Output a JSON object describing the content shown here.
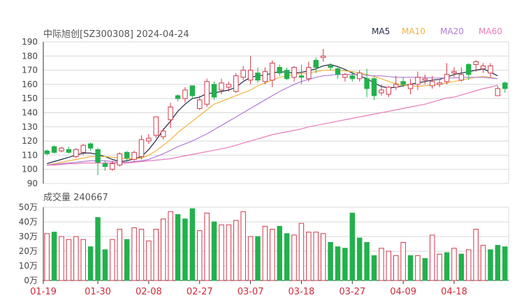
{
  "header": {
    "title": "中际旭创[SZ300308] 2024-04-24",
    "volume_label": "成交量 240667"
  },
  "legend": [
    {
      "label": "MA5",
      "color": "#1f2a44"
    },
    {
      "label": "MA10",
      "color": "#f2b33d"
    },
    {
      "label": "MA20",
      "color": "#b07ad6"
    },
    {
      "label": "MA60",
      "color": "#e87bb8"
    }
  ],
  "colors": {
    "up": "#d0384a",
    "down": "#22b14c",
    "xtick": "#d02a3b",
    "grid": "#d8d8d8"
  },
  "chart_data": [
    {
      "type": "candlestick",
      "title": "中际旭创[SZ300308] 2024-04-24",
      "ylim": [
        90,
        190
      ],
      "yticks": [
        "190",
        "180",
        "170",
        "160",
        "150",
        "140",
        "130",
        "120",
        "110",
        "100",
        "90"
      ],
      "xticks": [
        {
          "index": 0,
          "label": "01-19"
        },
        {
          "index": 7,
          "label": "01-30"
        },
        {
          "index": 14,
          "label": "02-08"
        },
        {
          "index": 21,
          "label": "02-27"
        },
        {
          "index": 28,
          "label": "03-07"
        },
        {
          "index": 35,
          "label": "03-18"
        },
        {
          "index": 42,
          "label": "03-27"
        },
        {
          "index": 49,
          "label": "04-09"
        },
        {
          "index": 56,
          "label": "04-18"
        }
      ],
      "candles": [
        [
          113,
          111,
          114,
          110
        ],
        [
          116,
          112,
          117,
          111
        ],
        [
          113,
          115,
          116,
          112
        ],
        [
          114,
          112,
          116,
          111
        ],
        [
          109,
          114,
          115,
          108
        ],
        [
          112,
          117,
          118,
          110
        ],
        [
          118,
          115,
          119,
          113
        ],
        [
          114,
          105,
          115,
          96
        ],
        [
          104,
          102,
          106,
          99
        ],
        [
          100,
          104,
          106,
          99
        ],
        [
          103,
          111,
          112,
          102
        ],
        [
          112,
          108,
          113,
          106
        ],
        [
          107,
          112,
          113,
          106
        ],
        [
          109,
          121,
          124,
          107
        ],
        [
          120,
          122,
          125,
          118
        ],
        [
          124,
          137,
          137,
          122
        ],
        [
          123,
          127,
          129,
          121
        ],
        [
          135,
          144,
          147,
          129
        ],
        [
          152,
          150,
          153,
          148
        ],
        [
          150,
          156,
          158,
          147
        ],
        [
          159,
          152,
          159,
          150
        ],
        [
          143,
          149,
          152,
          142
        ],
        [
          146,
          162,
          164,
          144
        ],
        [
          160,
          151,
          162,
          149
        ],
        [
          156,
          161,
          164,
          153
        ],
        [
          158,
          160,
          162,
          155
        ],
        [
          155,
          166,
          168,
          154
        ],
        [
          165,
          170,
          173,
          163
        ],
        [
          163,
          170,
          180,
          160
        ],
        [
          168,
          163,
          172,
          161
        ],
        [
          162,
          169,
          172,
          160
        ],
        [
          163,
          175,
          177,
          158
        ],
        [
          172,
          168,
          174,
          166
        ],
        [
          170,
          164,
          172,
          163
        ],
        [
          165,
          172,
          173,
          162
        ],
        [
          166,
          165,
          174,
          160
        ],
        [
          164,
          172,
          176,
          162
        ],
        [
          177,
          172,
          179,
          168
        ],
        [
          179,
          180,
          185,
          176
        ],
        [
          173,
          172,
          175,
          170
        ],
        [
          171,
          167,
          173,
          164
        ],
        [
          165,
          167,
          168,
          162
        ],
        [
          166,
          164,
          169,
          162
        ],
        [
          164,
          168,
          170,
          162
        ],
        [
          164,
          157,
          171,
          151
        ],
        [
          164,
          152,
          165,
          149
        ],
        [
          154,
          156,
          160,
          152
        ],
        [
          153,
          158,
          159,
          151
        ],
        [
          158,
          160,
          166,
          156
        ],
        [
          162,
          160,
          165,
          158
        ],
        [
          157,
          160,
          164,
          153
        ],
        [
          160,
          165,
          169,
          156
        ],
        [
          163,
          164,
          167,
          160
        ],
        [
          159,
          162,
          166,
          157
        ],
        [
          160,
          161,
          163,
          158
        ],
        [
          162,
          167,
          175,
          160
        ],
        [
          168,
          169,
          172,
          165
        ],
        [
          163,
          167,
          172,
          162
        ],
        [
          174,
          167,
          175,
          163
        ],
        [
          174,
          176,
          177,
          169
        ],
        [
          171,
          173,
          175,
          168
        ],
        [
          168,
          173,
          175,
          165
        ],
        [
          152,
          157,
          159,
          152
        ],
        [
          161,
          157,
          162,
          154
        ]
      ],
      "series": [
        {
          "name": "MA5",
          "values": [
            104,
            105.5,
            107,
            108.5,
            110,
            111.5,
            111.5,
            110.5,
            109,
            107,
            105.5,
            106,
            107.5,
            109,
            114,
            120.5,
            128,
            134,
            141,
            146,
            150,
            151,
            153.5,
            154,
            155,
            156,
            158,
            162,
            165,
            166,
            166.5,
            168,
            169,
            168.5,
            168,
            168.5,
            169.5,
            171,
            173,
            174,
            172.5,
            170.5,
            168,
            166,
            164,
            161,
            158.5,
            157.5,
            158,
            159,
            160,
            161,
            162,
            163,
            163.5,
            165,
            167,
            168,
            169,
            170,
            171,
            168.5,
            166
          ]
        },
        {
          "name": "MA10",
          "values": [
            103,
            104,
            105,
            106,
            107,
            108,
            109,
            109,
            109,
            108.5,
            108,
            107.5,
            107.5,
            108,
            110,
            113,
            117,
            121,
            126,
            130,
            134,
            138,
            142,
            146,
            148,
            150,
            152,
            154,
            156,
            159,
            161,
            163,
            165,
            166,
            167,
            167.5,
            168,
            169,
            170,
            170,
            170,
            169.5,
            169,
            168,
            167,
            165.5,
            164,
            162,
            160.5,
            159.5,
            159,
            158.5,
            159,
            159.5,
            160,
            161,
            162,
            163,
            164,
            165,
            165.5,
            165,
            164
          ]
        },
        {
          "name": "MA20",
          "values": [
            103,
            103.5,
            104,
            104.5,
            105,
            105.5,
            106,
            106,
            106,
            105.5,
            105,
            105,
            105.5,
            106,
            107,
            109,
            111,
            113.5,
            116,
            118,
            120,
            122.5,
            125,
            128,
            131,
            134,
            137,
            140,
            143,
            146,
            149,
            152,
            155,
            157.5,
            160,
            162,
            163.5,
            165,
            166,
            166.5,
            167,
            167,
            167,
            167,
            166.5,
            166,
            166,
            165.5,
            165,
            165,
            165,
            165,
            165,
            164.5,
            164.5,
            164.5,
            164.5,
            165,
            165,
            165,
            165,
            164.5,
            164
          ]
        },
        {
          "name": "MA60",
          "values": [
            103,
            103,
            103.5,
            104,
            104,
            104.5,
            104.5,
            104.5,
            104.5,
            104.5,
            104.5,
            104.5,
            105,
            105.5,
            106,
            106.5,
            107,
            107.5,
            108.5,
            109.5,
            110.5,
            111.5,
            112.5,
            113.5,
            114.5,
            115.5,
            117,
            118.5,
            120,
            121.5,
            123,
            124.5,
            125.5,
            126.5,
            127.5,
            128.5,
            130,
            131,
            132,
            133,
            134,
            135,
            136,
            137,
            138,
            139,
            140,
            141,
            142,
            143,
            144,
            145,
            146,
            147.5,
            149,
            150.5,
            151,
            152.5,
            154,
            155.5,
            157,
            158,
            159.5
          ]
        }
      ]
    },
    {
      "type": "bar",
      "title": "成交量 240667",
      "ylim": [
        0,
        50
      ],
      "yticks": [
        "50万",
        "40万",
        "30万",
        "20万",
        "10万",
        "0万"
      ],
      "values": [
        32,
        33,
        30,
        28,
        30,
        28,
        23,
        43,
        21,
        28,
        35,
        28,
        36,
        35,
        27,
        35,
        42,
        47,
        45,
        42,
        49,
        34,
        46,
        40,
        38,
        38,
        41,
        47,
        30,
        30,
        37,
        35,
        37,
        32,
        31,
        39,
        33,
        33,
        32,
        26,
        23,
        22,
        46,
        29,
        26,
        17,
        22,
        20,
        17,
        26,
        17,
        17,
        15,
        31,
        18,
        19,
        22,
        18,
        21,
        35,
        24,
        21,
        24,
        23
      ],
      "up_flags": [
        1,
        0,
        1,
        1,
        1,
        1,
        0,
        0,
        0,
        1,
        1,
        0,
        1,
        1,
        1,
        1,
        1,
        1,
        0,
        0,
        0,
        1,
        1,
        0,
        1,
        1,
        1,
        1,
        1,
        0,
        1,
        1,
        0,
        0,
        1,
        1,
        1,
        1,
        1,
        0,
        0,
        0,
        0,
        0,
        0,
        0,
        1,
        1,
        1,
        1,
        0,
        1,
        0,
        1,
        1,
        0,
        1,
        0,
        1,
        1,
        1,
        0,
        0,
        0
      ]
    }
  ]
}
